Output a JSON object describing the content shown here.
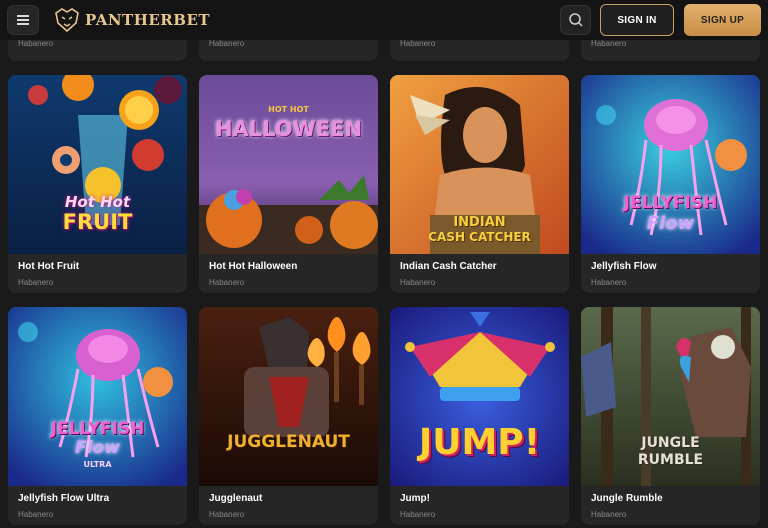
{
  "header": {
    "logo_text": "PANTHERBET",
    "signin_label": "SIGN IN",
    "signup_label": "SIGN UP"
  },
  "partial_row": [
    {
      "provider": "Habanero"
    },
    {
      "provider": "Habanero"
    },
    {
      "provider": "Habanero"
    },
    {
      "provider": "Habanero"
    }
  ],
  "games": [
    {
      "title": "Hot Hot Fruit",
      "provider": "Habanero",
      "art_line1": "Hot Hot",
      "art_line2": "FRUIT"
    },
    {
      "title": "Hot Hot Halloween",
      "provider": "Habanero",
      "art_line1": "HOT HOT",
      "art_line2": "HALLOWEEN"
    },
    {
      "title": "Indian Cash Catcher",
      "provider": "Habanero",
      "art_line1": "INDIAN",
      "art_line2": "CASH CATCHER"
    },
    {
      "title": "Jellyfish Flow",
      "provider": "Habanero",
      "art_line1": "JELLYFISH",
      "art_line2": "Flow"
    },
    {
      "title": "Jellyfish Flow Ultra",
      "provider": "Habanero",
      "art_line1": "JELLYFISH",
      "art_line2": "Flow",
      "art_line3": "ULTRA"
    },
    {
      "title": "Jugglenaut",
      "provider": "Habanero",
      "art_line1": "JUGGLENAUT"
    },
    {
      "title": "Jump!",
      "provider": "Habanero",
      "art_line1": "JUMP!"
    },
    {
      "title": "Jungle Rumble",
      "provider": "Habanero",
      "art_line1": "JUNGLE",
      "art_line2": "RUMBLE"
    }
  ],
  "colors": {
    "accent_gold": "#e3b06c",
    "card_bg": "#262626",
    "page_bg": "#1a1a1a"
  }
}
